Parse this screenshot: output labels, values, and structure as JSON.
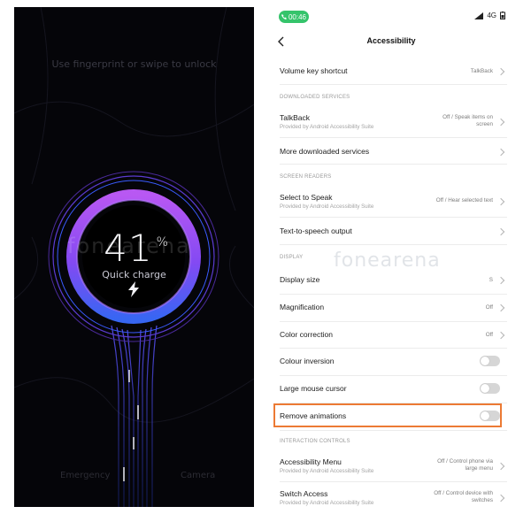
{
  "charging": {
    "percent": "41",
    "percent_sign": "%",
    "status": "Quick charge",
    "unlock_hint": "Use fingerprint or swipe to unlock",
    "watermark": "fonearena",
    "bottom_left": "Emergency",
    "bottom_right": "Camera",
    "colors": {
      "ring_outer": "#6a3cff",
      "ring_inner": "#b04cff",
      "ring_blue": "#3f6bff"
    }
  },
  "status_bar": {
    "call_time": "00:46",
    "network": "4G",
    "icons": [
      "signal-icon",
      "battery-icon"
    ]
  },
  "header": {
    "back_icon": "chevron-left-icon",
    "title": "Accessibility"
  },
  "watermark": "fonearena",
  "settings": {
    "volume_key": {
      "label": "Volume key shortcut",
      "value": "TalkBack"
    },
    "downloaded_services_header": "DOWNLOADED SERVICES",
    "talkback": {
      "label": "TalkBack",
      "sub": "Provided by Android Accessibility Suite",
      "value_line1": "Off / Speak items on",
      "value_line2": "screen"
    },
    "more_downloaded": {
      "label": "More downloaded services"
    },
    "screen_readers_header": "SCREEN READERS",
    "select_to_speak": {
      "label": "Select to Speak",
      "sub": "Provided by Android Accessibility Suite",
      "value": "Off / Hear selected text"
    },
    "tts_output": {
      "label": "Text-to-speech output"
    },
    "display_header": "DISPLAY",
    "display_size": {
      "label": "Display size",
      "value": "S"
    },
    "magnification": {
      "label": "Magnification",
      "value": "Off"
    },
    "color_correction": {
      "label": "Color correction",
      "value": "Off"
    },
    "colour_inversion": {
      "label": "Colour inversion",
      "toggle": false
    },
    "large_mouse_cursor": {
      "label": "Large mouse cursor",
      "toggle": false
    },
    "remove_animations": {
      "label": "Remove animations",
      "toggle": false
    },
    "interaction_controls_header": "INTERACTION CONTROLS",
    "accessibility_menu": {
      "label": "Accessibility Menu",
      "sub": "Provided by Android Accessibility Suite",
      "value_line1": "Off / Control phone via",
      "value_line2": "large menu"
    },
    "switch_access": {
      "label": "Switch Access",
      "sub": "Provided by Android Accessibility Suite",
      "value_line1": "Off / Control device with",
      "value_line2": "switches"
    }
  },
  "highlight_color": "#ec7a34"
}
